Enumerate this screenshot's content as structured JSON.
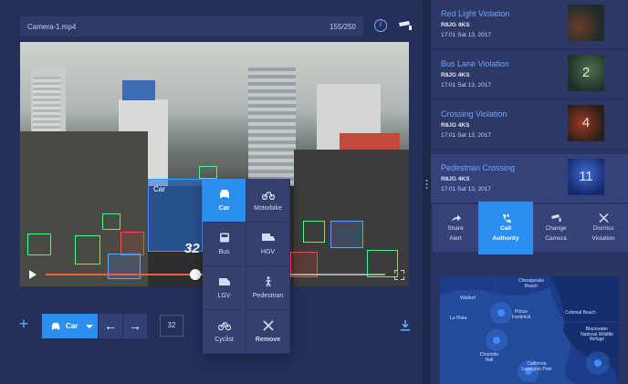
{
  "file_bar": {
    "filename": "Camera-1.mp4",
    "frame_counter": "155/250"
  },
  "video": {
    "selected_label": "Car",
    "count_badge": "32",
    "progress": 0.44
  },
  "vehicle_menu": {
    "items": [
      {
        "label": "Car",
        "icon": "car-icon",
        "active": true
      },
      {
        "label": "Motorbike",
        "icon": "motorbike-icon"
      },
      {
        "label": "Bus",
        "icon": "bus-icon"
      },
      {
        "label": "HGV",
        "icon": "truck-icon"
      },
      {
        "label": "LGV",
        "icon": "van-icon"
      },
      {
        "label": "Pedestrian",
        "icon": "pedestrian-icon"
      },
      {
        "label": "Cyclist",
        "icon": "bicycle-icon"
      },
      {
        "label": "Remove",
        "icon": "close-icon"
      }
    ]
  },
  "toolbar": {
    "type_label": "Car",
    "count": "32"
  },
  "violations": [
    {
      "title": "Red Light Violation",
      "plate": "R8JG 4KS",
      "time": "17:01 Sat 13, 2017",
      "thumb_number": ""
    },
    {
      "title": "Bus Lane Violation",
      "plate": "R8JG 4KS",
      "time": "17:01 Sat 13, 2017",
      "thumb_number": "2"
    },
    {
      "title": "Crossing Violation",
      "plate": "R8JG 4KS",
      "time": "17:01 Sat 13, 2017",
      "thumb_number": "4"
    },
    {
      "title": "Pedestrian Crossing",
      "plate": "R8JG 4KS",
      "time": "17:01 Sat 13, 2017",
      "thumb_number": "11"
    }
  ],
  "actions": [
    {
      "line1": "Share",
      "line2": "Alert",
      "icon": "share-icon"
    },
    {
      "line1": "Call",
      "line2": "Authority",
      "icon": "phone-icon",
      "primary": true
    },
    {
      "line1": "Change",
      "line2": "Camera",
      "icon": "camera-icon"
    },
    {
      "line1": "Dismiss",
      "line2": "Violation",
      "icon": "close-icon"
    }
  ],
  "map": {
    "labels": [
      "Chesapeake Beach",
      "Waldorf",
      "Prince Frederick",
      "La Plata",
      "Charlotte Hall",
      "California Lexington Park",
      "Colonial Beach",
      "Blackwater National Wildlife Refuge"
    ]
  },
  "colors": {
    "accent": "#2a8ff0",
    "title_blue": "#6fa6ff",
    "bg": "#232c52"
  }
}
